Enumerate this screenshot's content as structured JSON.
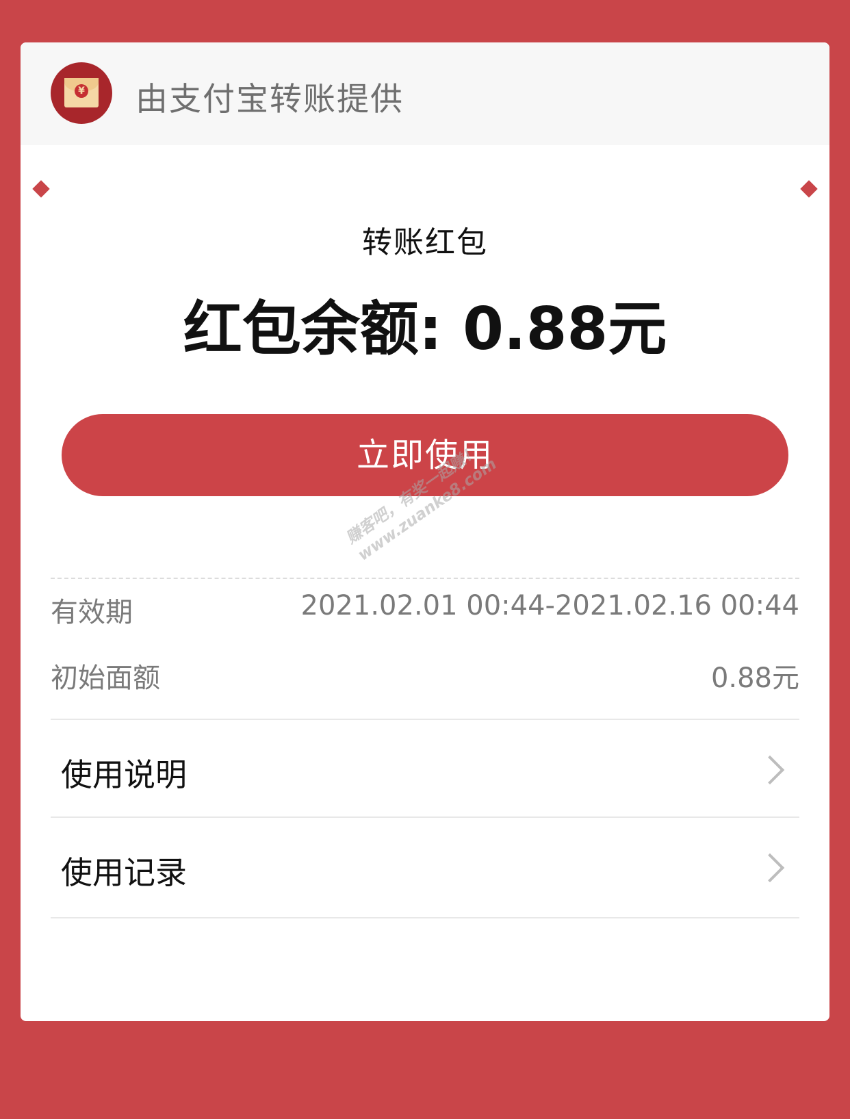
{
  "header": {
    "title": "由支付宝转账提供",
    "logo_icon": "red-envelope-icon",
    "logo_coin": "¥"
  },
  "main": {
    "subtitle": "转账红包",
    "balance_text": "红包余额: 0.88元",
    "use_button_label": "立即使用"
  },
  "details": {
    "validity_label": "有效期",
    "validity_value": "2021.02.01 00:44-2021.02.16 00:44",
    "initial_amount_label": "初始面额",
    "initial_amount_value": "0.88元"
  },
  "menu": {
    "items": [
      {
        "label": "使用说明",
        "icon": "chevron-right-icon"
      },
      {
        "label": "使用记录",
        "icon": "chevron-right-icon"
      }
    ]
  },
  "watermark": {
    "line1": "赚客吧，有奖一起赚！",
    "line2": "www.zuanke8.com"
  },
  "colors": {
    "background": "#c94549",
    "button": "#cc4448",
    "card": "#ffffff"
  }
}
